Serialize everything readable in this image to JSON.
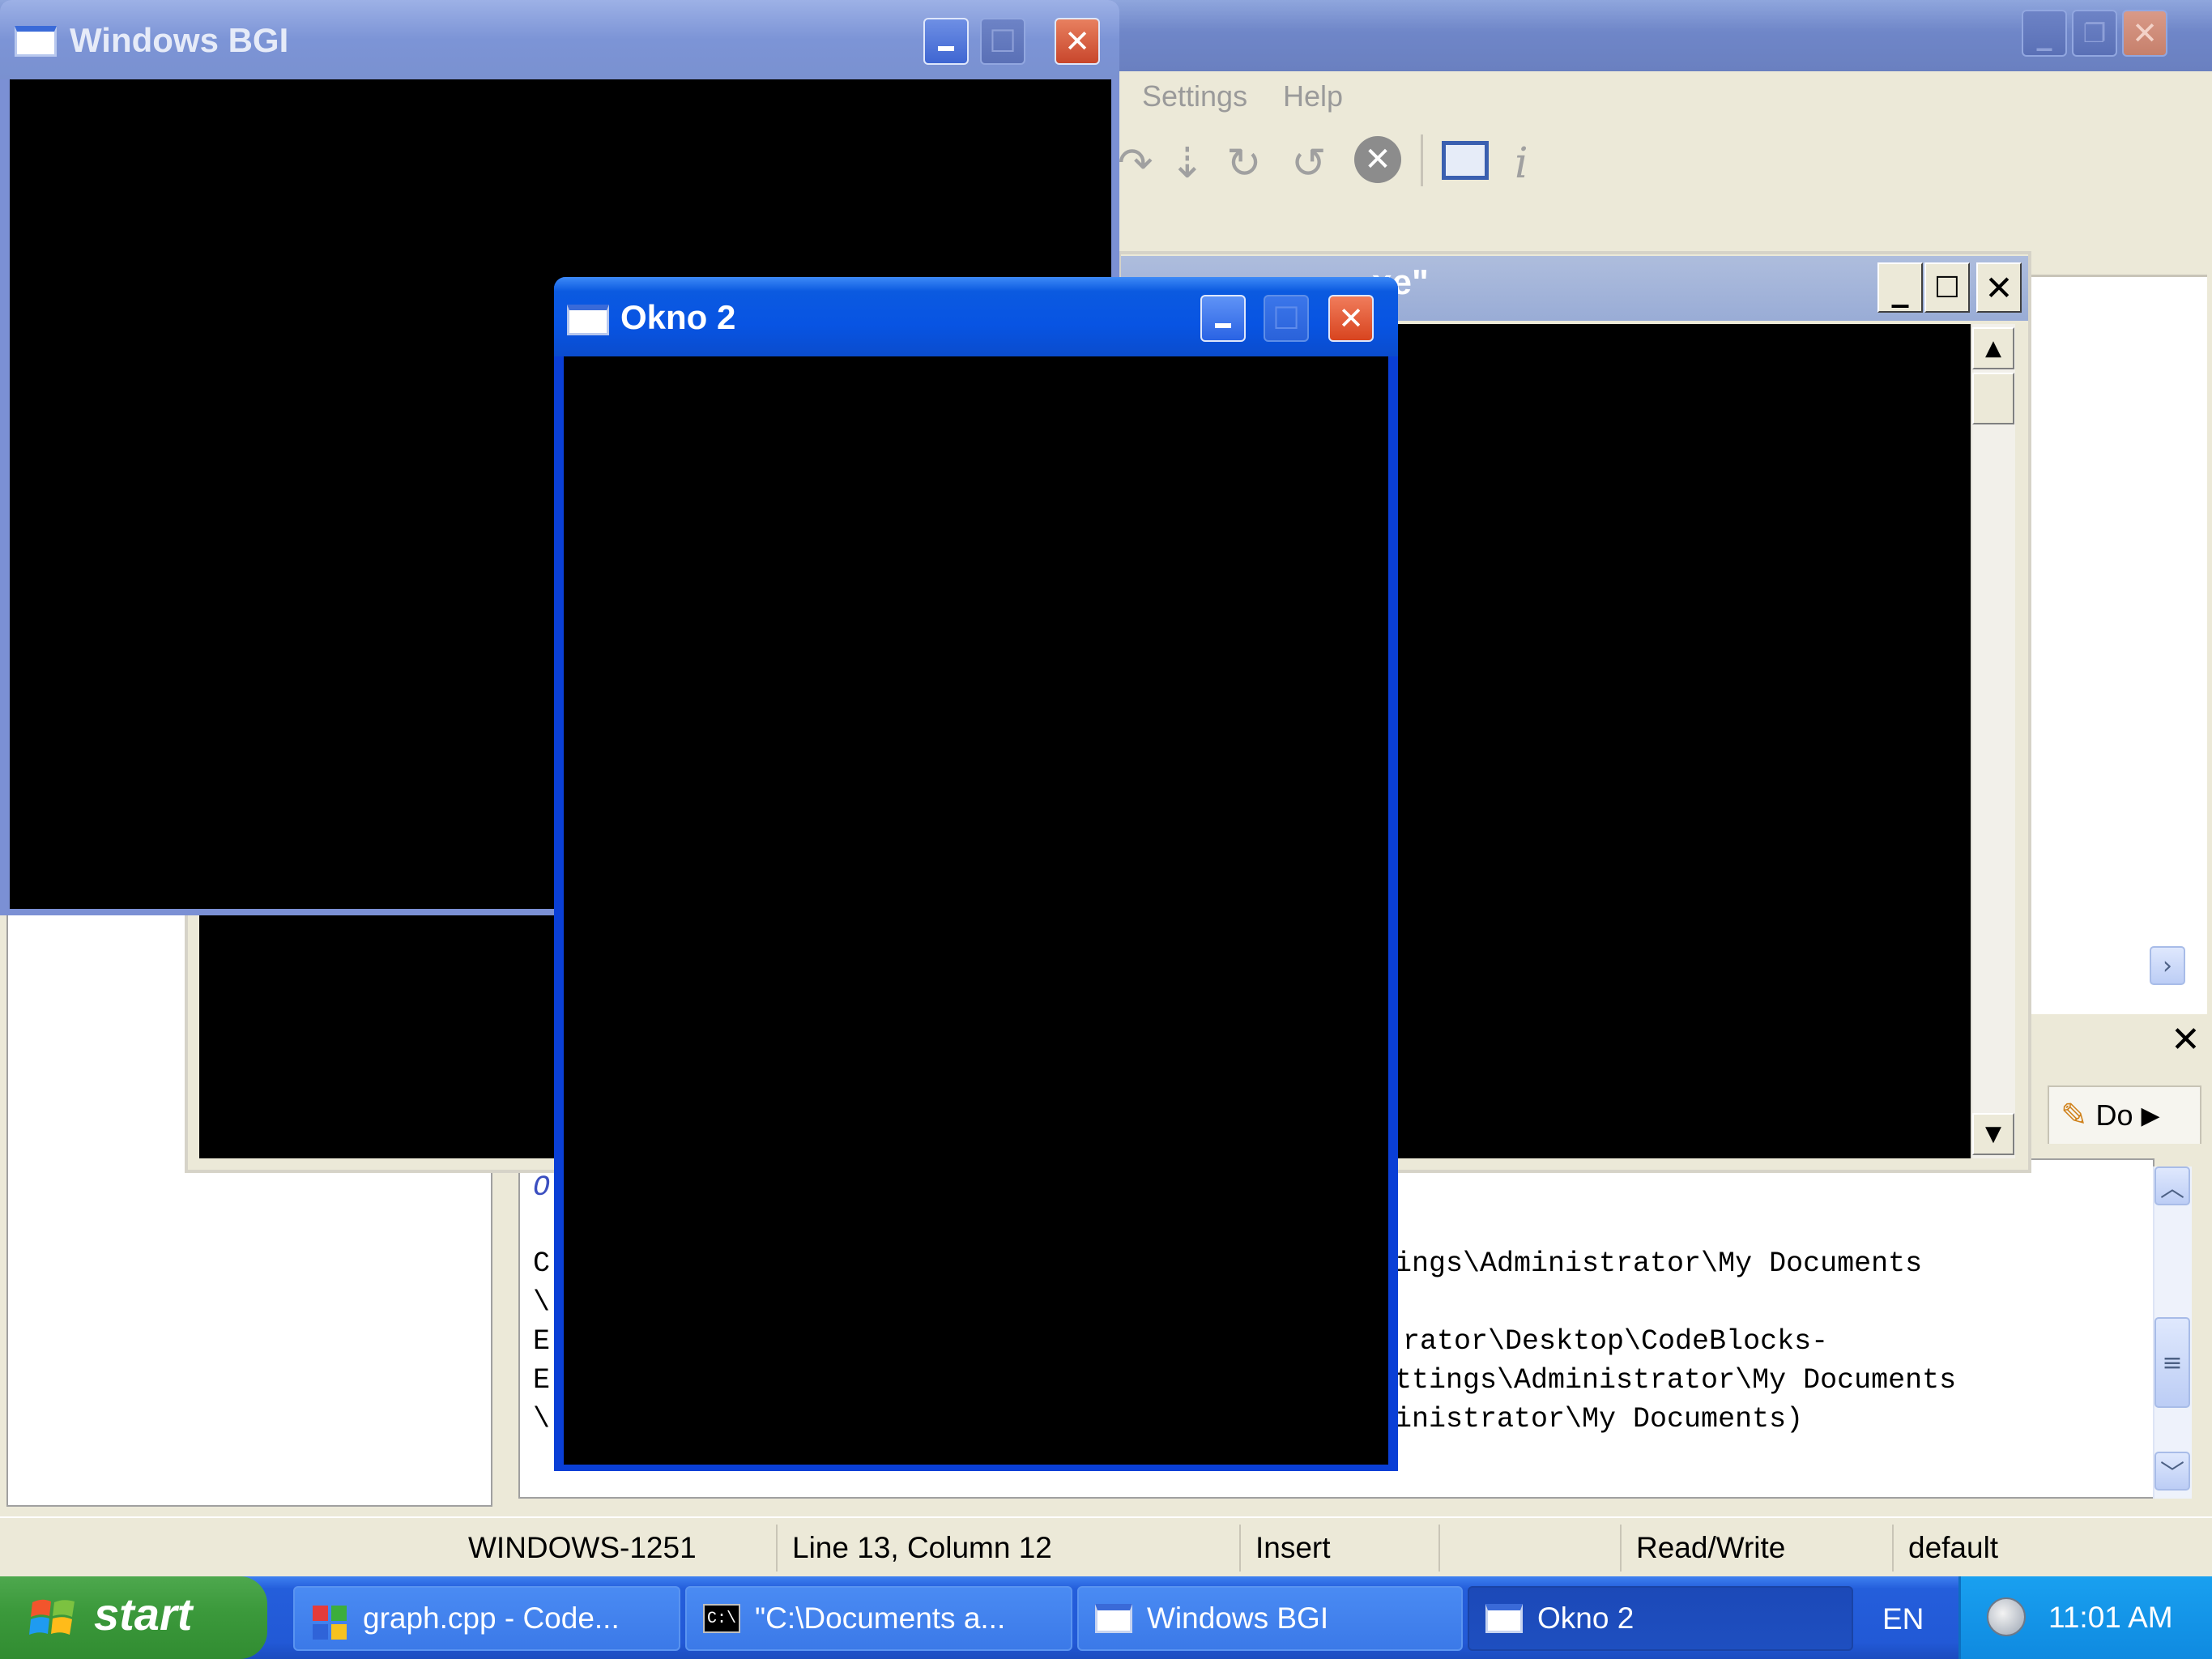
{
  "ide": {
    "menu": {
      "settings": "Settings",
      "help": "Help"
    },
    "toolbar_icons": [
      "debug-step-into-icon",
      "debug-next-line-icon",
      "debug-step-icon",
      "debug-step-out-icon",
      "debug-stop-icon",
      "debug-windows-icon",
      "info-icon"
    ],
    "logs_tab_label": "Do",
    "log_lines": [
      {
        "left": "C",
        "right": "ings\\Administrator\\My Documents"
      },
      {
        "left": "\\",
        "right": ""
      },
      {
        "left": "E",
        "right": "rator\\Desktop\\CodeBlocks-"
      },
      {
        "left": "E",
        "right": "ttings\\Administrator\\My Documents"
      },
      {
        "left": "\\",
        "right": "inistrator\\My Documents)"
      }
    ],
    "log_top_fragment": "O"
  },
  "statusbar": {
    "encoding": "WINDOWS-1251",
    "position": "Line 13, Column 12",
    "mode": "Insert",
    "access": "Read/Write",
    "profile": "default"
  },
  "console_window": {
    "title_fragment": "xe\""
  },
  "bgi_window": {
    "title": "Windows BGI"
  },
  "okno_window": {
    "title": "Okno 2"
  },
  "taskbar": {
    "start_label": "start",
    "tasks": [
      {
        "label": "graph.cpp - Code...",
        "icon": "codeblocks-icon"
      },
      {
        "label": "\"C:\\Documents a...",
        "icon": "console-icon",
        "icon_text": "C:\\"
      },
      {
        "label": "Windows BGI",
        "icon": "window-icon"
      },
      {
        "label": "Okno 2",
        "icon": "window-icon"
      }
    ],
    "language": "EN",
    "clock": "11:01 AM"
  },
  "colors": {
    "active_title": "#0854e3",
    "inactive_title": "#7c94d6",
    "taskbar": "#245edb",
    "start_green": "#3c9a3c"
  }
}
